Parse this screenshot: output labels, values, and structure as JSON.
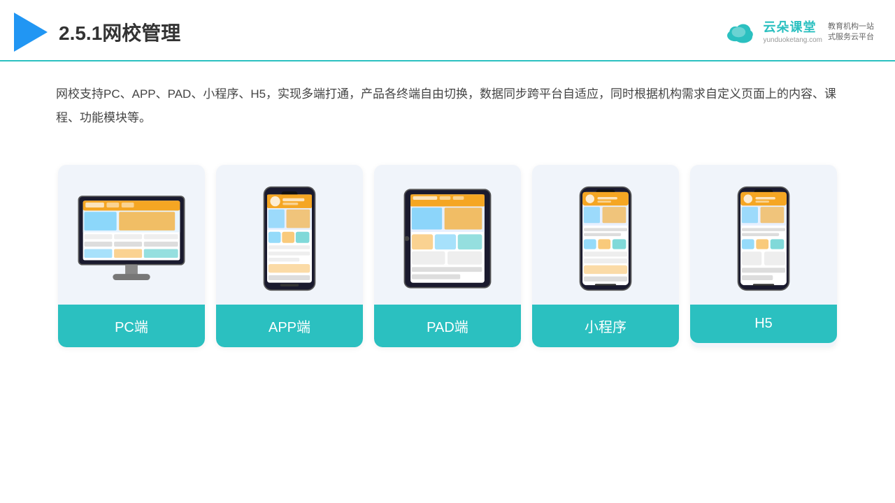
{
  "header": {
    "title": "2.5.1网校管理",
    "brand": {
      "name": "云朵课堂",
      "url": "yunduoketang.com",
      "tagline": "教育机构一站\n式服务云平台"
    }
  },
  "description": "网校支持PC、APP、PAD、小程序、H5，实现多端打通，产品各终端自由切换，数据同步跨平台自适应，同时根据机构需求自定义页面上的内容、课程、功能模块等。",
  "cards": [
    {
      "id": "pc",
      "label": "PC端"
    },
    {
      "id": "app",
      "label": "APP端"
    },
    {
      "id": "pad",
      "label": "PAD端"
    },
    {
      "id": "mini",
      "label": "小程序"
    },
    {
      "id": "h5",
      "label": "H5"
    }
  ],
  "colors": {
    "accent": "#2bc0c0",
    "header_line": "#2bc0c0",
    "card_bg": "#eef2f9",
    "label_bg": "#2bc0c0"
  }
}
